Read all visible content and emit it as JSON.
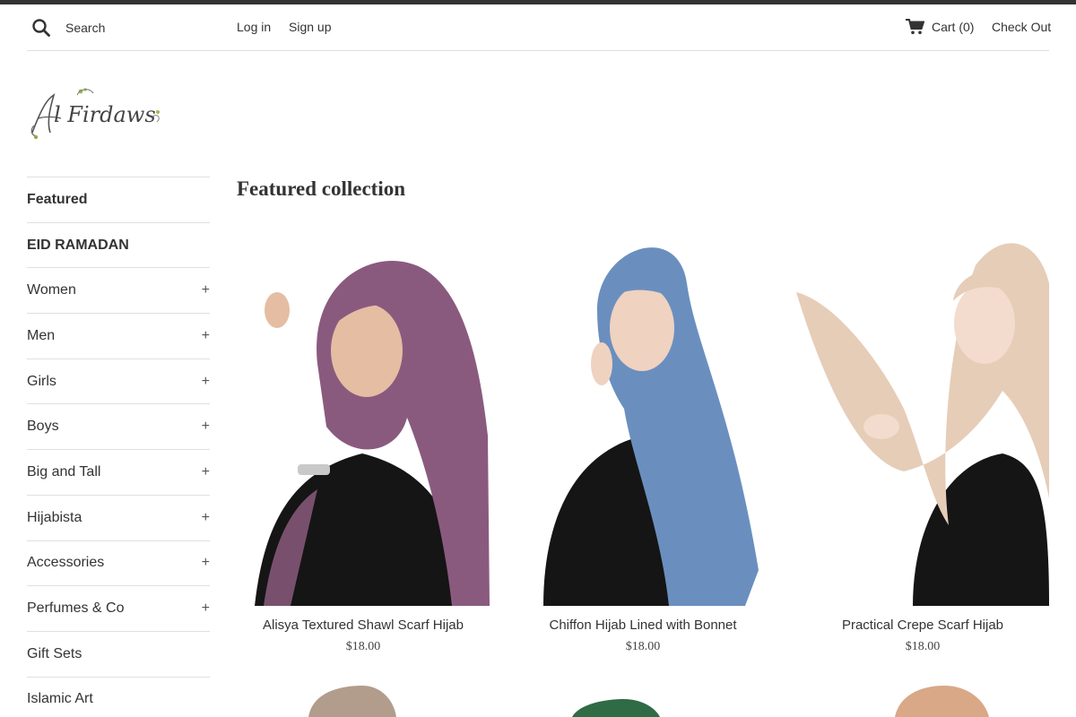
{
  "header": {
    "search_placeholder": "Search",
    "login_label": "Log in",
    "signup_label": "Sign up",
    "cart_label": "Cart (0)",
    "checkout_label": "Check Out"
  },
  "logo": {
    "text": "Al Firdaws"
  },
  "sidebar": {
    "items": [
      {
        "label": "Featured",
        "expandable": false
      },
      {
        "label": "EID RAMADAN",
        "expandable": false
      },
      {
        "label": "Women",
        "expandable": true
      },
      {
        "label": "Men",
        "expandable": true
      },
      {
        "label": "Girls",
        "expandable": true
      },
      {
        "label": "Boys",
        "expandable": true
      },
      {
        "label": "Big and Tall",
        "expandable": true
      },
      {
        "label": "Hijabista",
        "expandable": true
      },
      {
        "label": "Accessories",
        "expandable": true
      },
      {
        "label": "Perfumes & Co",
        "expandable": true
      },
      {
        "label": "Gift Sets",
        "expandable": false
      },
      {
        "label": "Islamic Art",
        "expandable": false
      }
    ],
    "expand_symbol": "+"
  },
  "main": {
    "title": "Featured collection",
    "products": [
      {
        "title": "Alisya Textured Shawl Scarf Hijab",
        "price": "$18.00",
        "color": "#8a5a7e"
      },
      {
        "title": "Chiffon Hijab Lined with Bonnet",
        "price": "$18.00",
        "color": "#6a8fbf"
      },
      {
        "title": "Practical Crepe Scarf Hijab",
        "price": "$18.00",
        "color": "#e6cdb8"
      }
    ],
    "row2_colors": [
      "#b29c8c",
      "#2f6b45",
      "#d8a887"
    ]
  },
  "colors": {
    "topbar": "#333333",
    "text": "#333333",
    "divider": "#e0e0e0"
  }
}
